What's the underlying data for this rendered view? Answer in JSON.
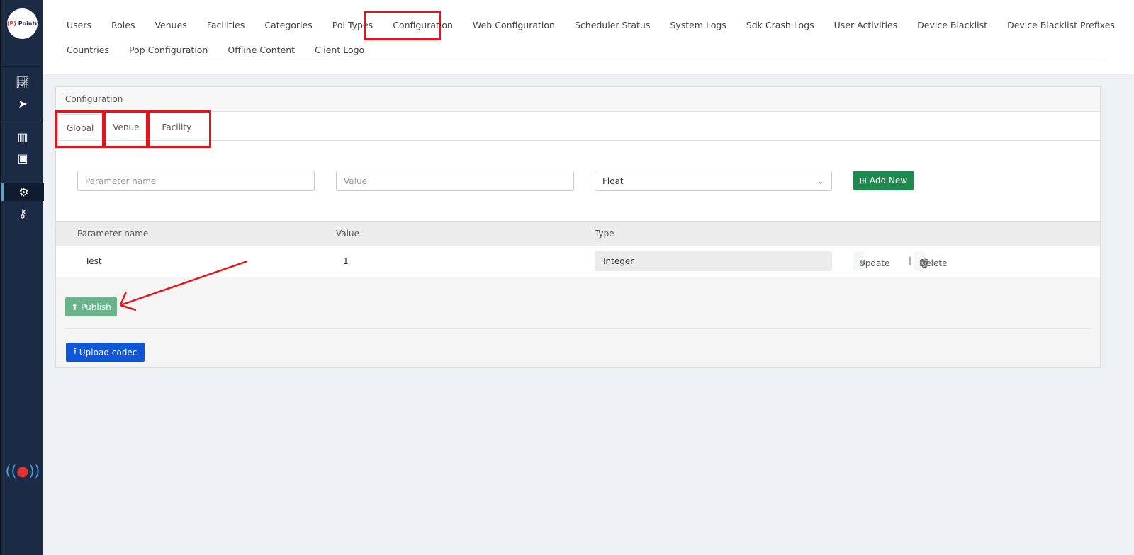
{
  "brand": {
    "logo_text": "Pointr"
  },
  "sidebar": {
    "icons": [
      "chart-area-icon",
      "location-arrow-icon",
      "map-icon",
      "object-group-icon",
      "gear-icon",
      "key-icon"
    ],
    "active": "gear-icon",
    "bottom_icon": "pointr-beacon-icon"
  },
  "nav": {
    "row1": [
      "Users",
      "Roles",
      "Venues",
      "Facilities",
      "Categories",
      "Poi Types",
      "Configuration",
      "Web Configuration",
      "Scheduler Status",
      "System Logs",
      "Sdk Crash Logs",
      "User Activities",
      "Device Blacklist",
      "Device Blacklist Prefixes"
    ],
    "row2": [
      "Countries",
      "Pop Configuration",
      "Offline Content",
      "Client Logo"
    ],
    "active": "Configuration"
  },
  "panel": {
    "title": "Configuration",
    "tabs": [
      "Global",
      "Venue",
      "Facility"
    ],
    "active_tab": "Global"
  },
  "form": {
    "param_placeholder": "Parameter name",
    "value_placeholder": "Value",
    "type_selected": "Float",
    "add_label": "Add New"
  },
  "table": {
    "headers": [
      "Parameter name",
      "Value",
      "Type"
    ],
    "rows": [
      {
        "name": "Test",
        "value": "1",
        "type": "Integer"
      }
    ],
    "update_label": "Update",
    "delete_label": "Delete"
  },
  "footer": {
    "publish_label": "Publish",
    "upload_label": "Upload codec"
  },
  "colors": {
    "sidebar": "#1b2b45",
    "add": "#1e8a4f",
    "publish": "#6bb38a",
    "upload": "#1156d6",
    "annotation": "#e3141c"
  }
}
